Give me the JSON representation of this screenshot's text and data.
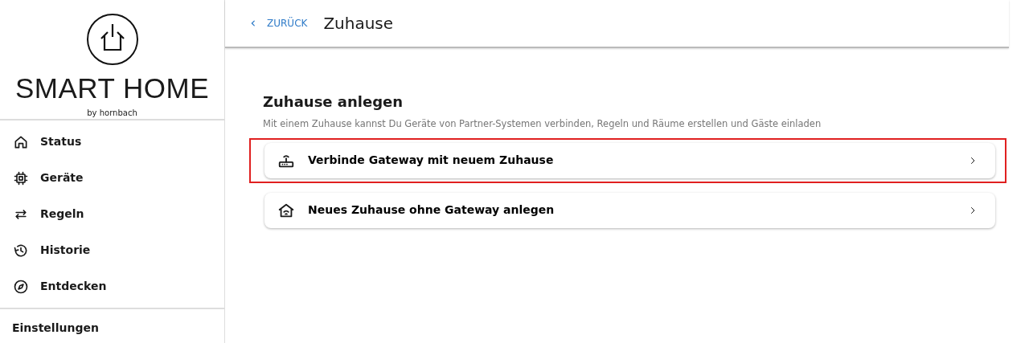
{
  "logo": {
    "title": "SMART HOME",
    "subtitle": "by hornbach"
  },
  "sidebar": {
    "items": [
      {
        "label": "Status"
      },
      {
        "label": "Geräte"
      },
      {
        "label": "Regeln"
      },
      {
        "label": "Historie"
      },
      {
        "label": "Entdecken"
      }
    ],
    "footer_item": "Einstellungen"
  },
  "header": {
    "back": "ZURÜCK",
    "title": "Zuhause"
  },
  "section": {
    "title": "Zuhause anlegen",
    "description": "Mit einem Zuhause kannst Du Geräte von Partner-Systemen verbinden, Regeln und Räume erstellen und Gäste einladen",
    "options": [
      {
        "label": "Verbinde Gateway mit neuem Zuhause",
        "highlighted": true
      },
      {
        "label": "Neues Zuhause ohne Gateway anlegen",
        "highlighted": false
      }
    ]
  }
}
